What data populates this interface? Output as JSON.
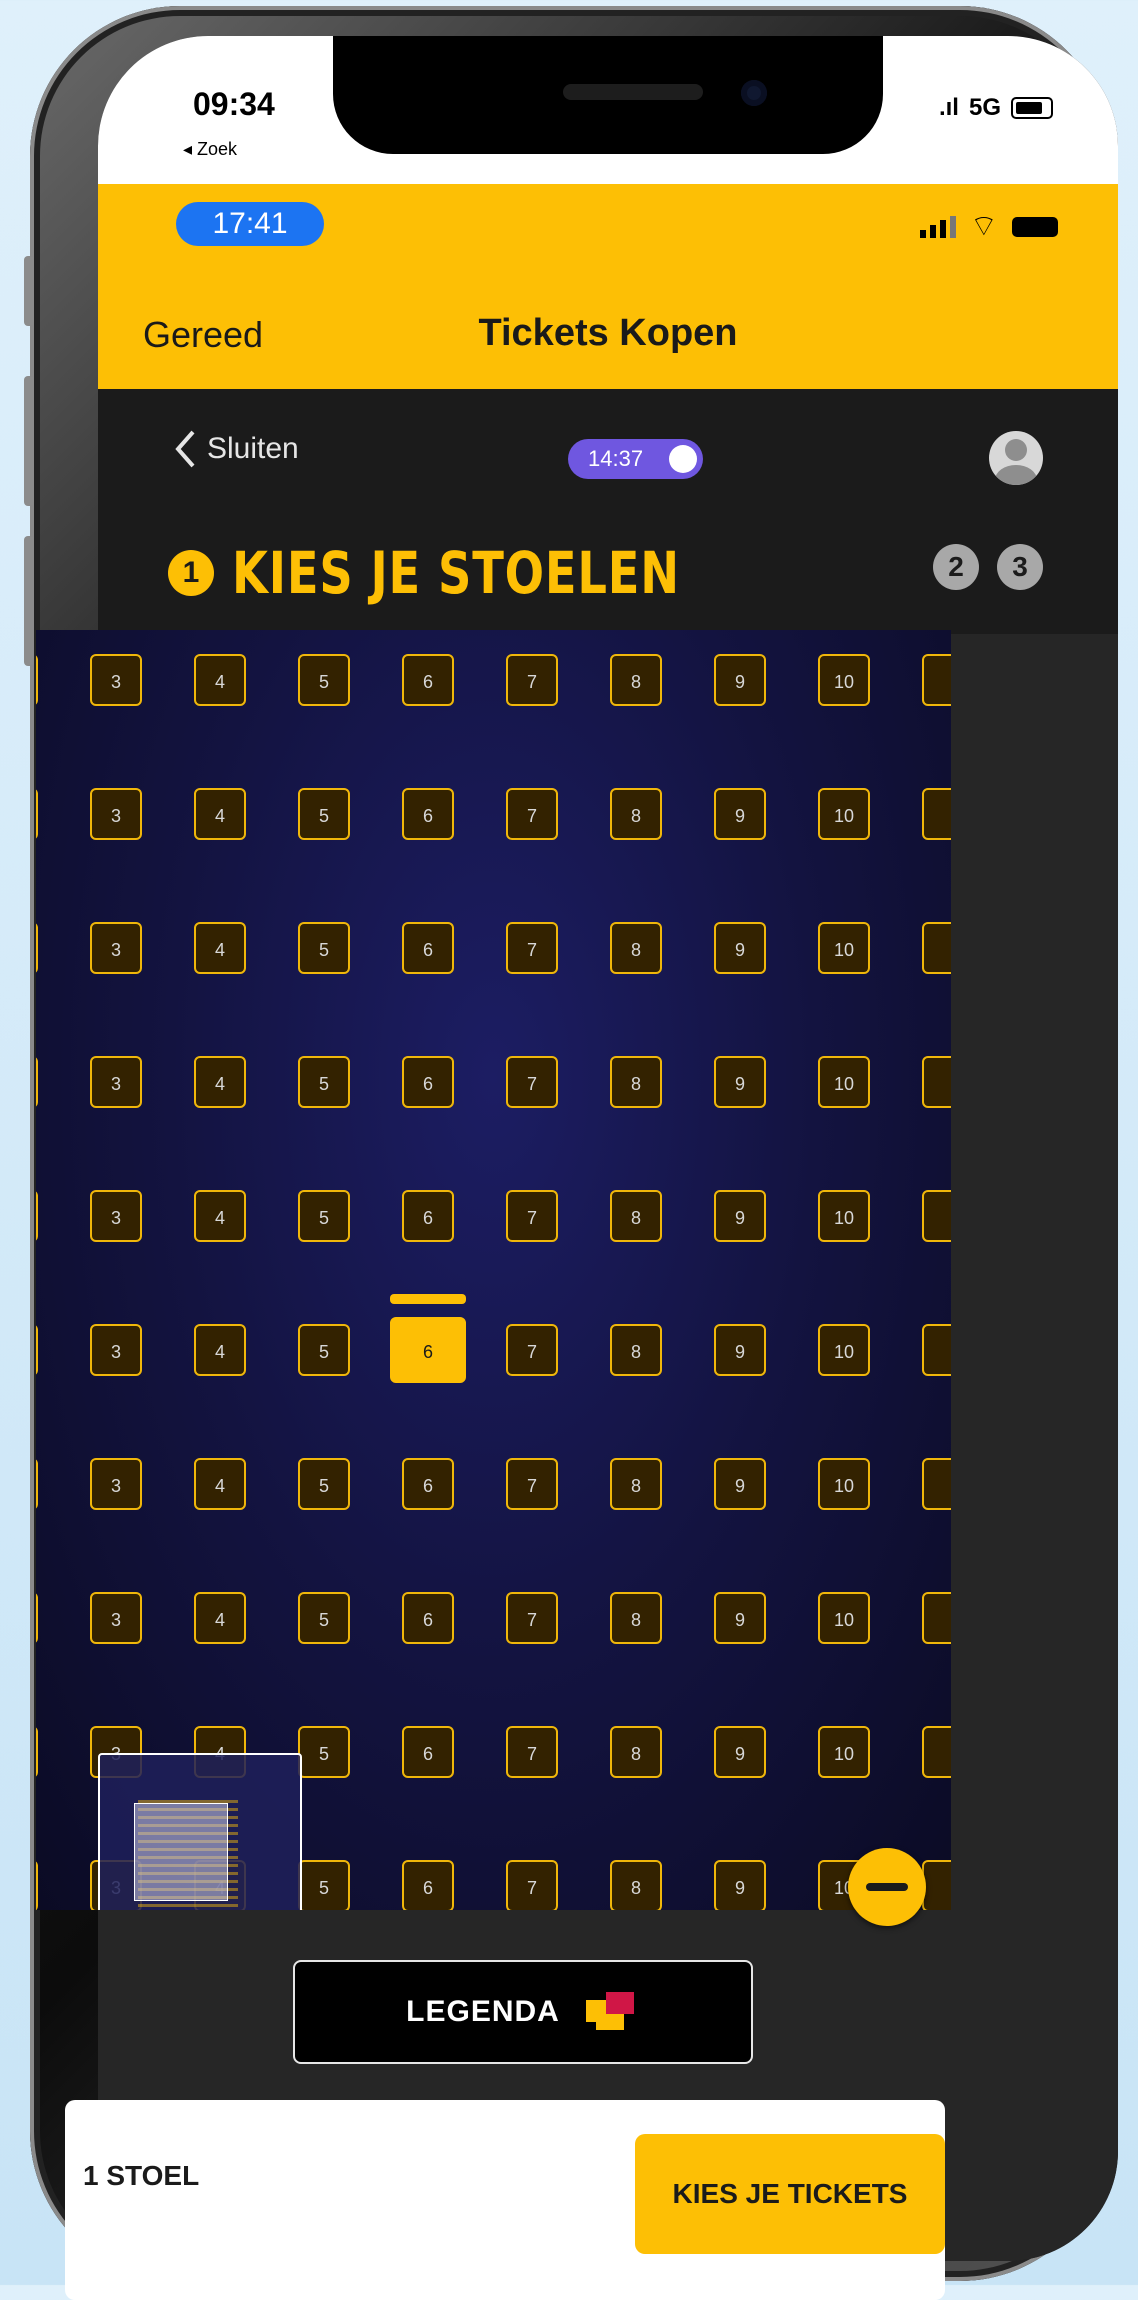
{
  "ios_status": {
    "time": "09:34",
    "back_app": "◂ Zoek",
    "network": "5G"
  },
  "app_status": {
    "time": "17:41"
  },
  "nav": {
    "done_label": "Gereed",
    "title": "Tickets Kopen"
  },
  "header": {
    "close_label": "Sluiten",
    "timer": "14:37",
    "step_number": "1",
    "step_title": "KIES JE STOELEN",
    "next_steps": [
      "2",
      "3"
    ]
  },
  "seatmap": {
    "rows": 10,
    "seat_numbers": [
      "3",
      "4",
      "5",
      "6",
      "7",
      "8",
      "9",
      "10"
    ],
    "selected_seat": {
      "row": 6,
      "number": "6"
    },
    "seat_color": "#f0b70a",
    "background_color": "#131340"
  },
  "legend_button": {
    "label": "LEGENDA"
  },
  "bottom": {
    "seat_label": "1 STOEL",
    "cta_label": "KIES JE TICKETS"
  },
  "colors": {
    "brand_yellow": "#fdbf05",
    "timer_purple": "#6f57e0",
    "ios_blue": "#1c74f2"
  }
}
